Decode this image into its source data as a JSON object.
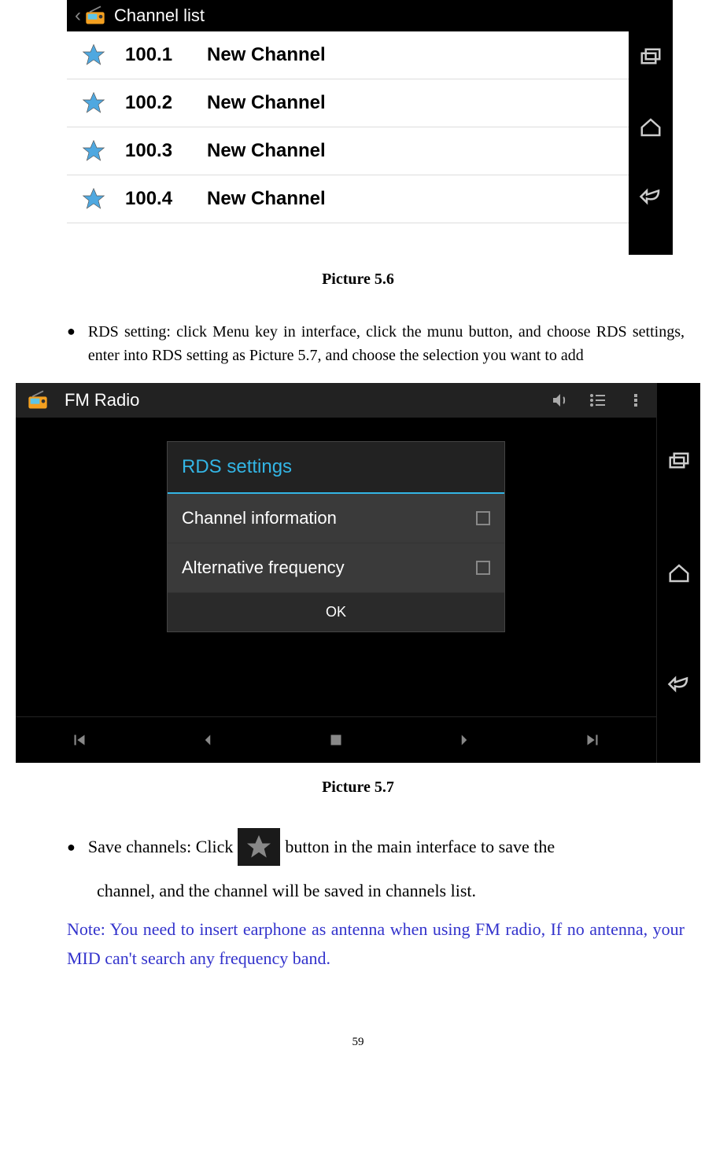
{
  "screenshot1": {
    "title": "Channel list",
    "items": [
      {
        "freq": "100.1",
        "name": "New Channel"
      },
      {
        "freq": "100.2",
        "name": "New Channel"
      },
      {
        "freq": "100.3",
        "name": "New Channel"
      },
      {
        "freq": "100.4",
        "name": "New Channel"
      }
    ]
  },
  "caption1": "Picture 5.6",
  "rds_para": "RDS setting: click Menu key in interface, click the munu button, and choose RDS settings, enter into RDS setting as Picture 5.7, and choose the selection you want to add",
  "screenshot2": {
    "title": "FM Radio",
    "dialog_title": "RDS settings",
    "item1": "Channel information",
    "item2": "Alternative frequency",
    "ok": "OK"
  },
  "caption2": "Picture 5.7",
  "save_pre": "Save  channels:  Click ",
  "save_post": "  button  in  the  main  interface  to  save  the",
  "save_cont": "channel, and the channel will be saved in channels list.",
  "note": "Note:  You  need  to  insert  earphone  as  antenna  when  using  FM  radio,  If  no antenna, your MID can't search any frequency band.",
  "page_num": "59"
}
